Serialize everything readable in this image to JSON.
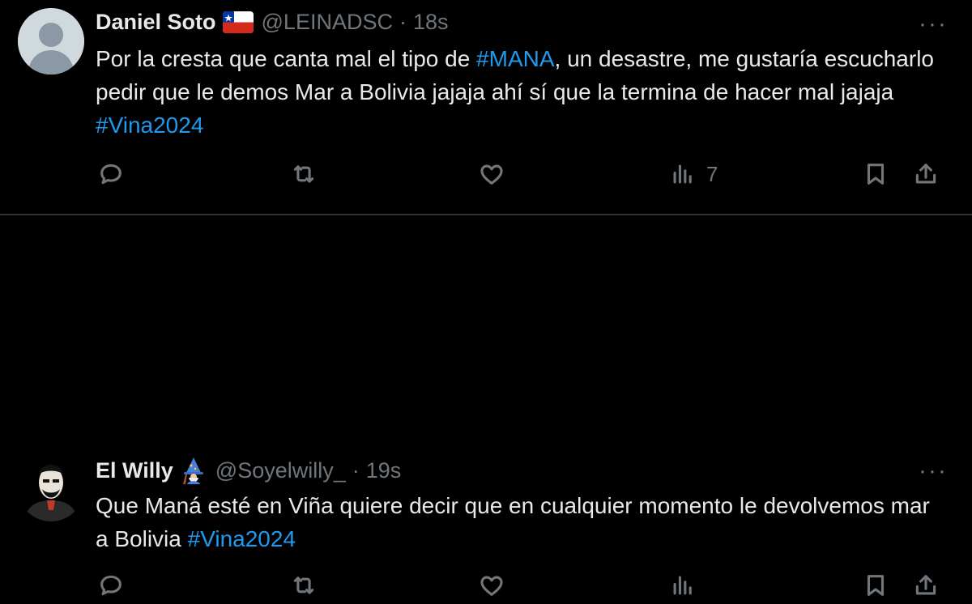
{
  "tweets": [
    {
      "name": "Daniel Soto",
      "badge_icon": "chile-flag-icon",
      "handle": "@LEINADSC",
      "separator": "·",
      "time": "18s",
      "more": "···",
      "text_parts": [
        {
          "text": "Por la cresta que canta mal el tipo de ",
          "hashtag": false
        },
        {
          "text": "#MANA",
          "hashtag": true
        },
        {
          "text": ", un desastre, me gustaría escucharlo pedir que le demos Mar a Bolivia jajaja ahí sí que la termina de hacer mal jajaja ",
          "hashtag": false
        },
        {
          "text": "#Vina2024",
          "hashtag": true
        }
      ],
      "actions": {
        "views_count": "7"
      }
    },
    {
      "name": "El Willy",
      "badge_icon": "wizard-emoji-icon",
      "handle": "@Soyelwilly_",
      "separator": "·",
      "time": "19s",
      "more": "···",
      "text_parts": [
        {
          "text": "Que Maná esté en Viña quiere decir que en cualquier momento le devolvemos mar a Bolivia ",
          "hashtag": false
        },
        {
          "text": "#Vina2024",
          "hashtag": true
        }
      ],
      "actions": {
        "views_count": ""
      }
    }
  ],
  "colors": {
    "background": "#000000",
    "text": "#e7e9ea",
    "muted": "#71767b",
    "hashtag": "#1d9bf0",
    "divider": "#2f3336"
  }
}
